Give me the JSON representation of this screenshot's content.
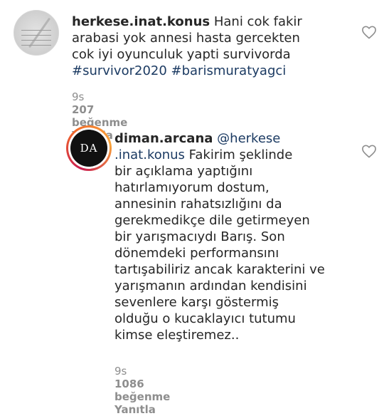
{
  "comments": [
    {
      "username": "herkese.inat.konus",
      "text": "Hani cok fakir\narabasi yok annesi hasta gercekten\ncok iyi oyunculuk yapti survivorda",
      "hashtags": "#survivor2020 #barismuratyagci",
      "time": "9s",
      "likes": "207 beğenme",
      "reply_label": "Yanıtla",
      "avatar_icon": "profile-photo-icon"
    },
    {
      "username": "diman.arcana",
      "mention": "@herkese\n.inat.konus",
      "text": "Fakirim şeklinde\nbir açıklama yaptığını\nhatırlamıyorum dostum,\nannesinin rahatsızlığını da\ngerekmedikçe dile getirmeyen\nbir yarışmacıydı Barış. Son\ndönemdeki performansını\ntartışabiliriz ancak karakterini ve\nyarışmanın ardından kendisini\nsevenlere karşı göstermiş\nolduğu o kucaklayıcı tutumu\nkimse eleştiremez..",
      "avatar_text": "DA",
      "time": "9s",
      "likes": "1086 beğenme",
      "reply_label": "Yanıtla"
    }
  ],
  "colors": {
    "text": "#262626",
    "link": "#1b3a62",
    "meta": "#8e8e8e"
  }
}
